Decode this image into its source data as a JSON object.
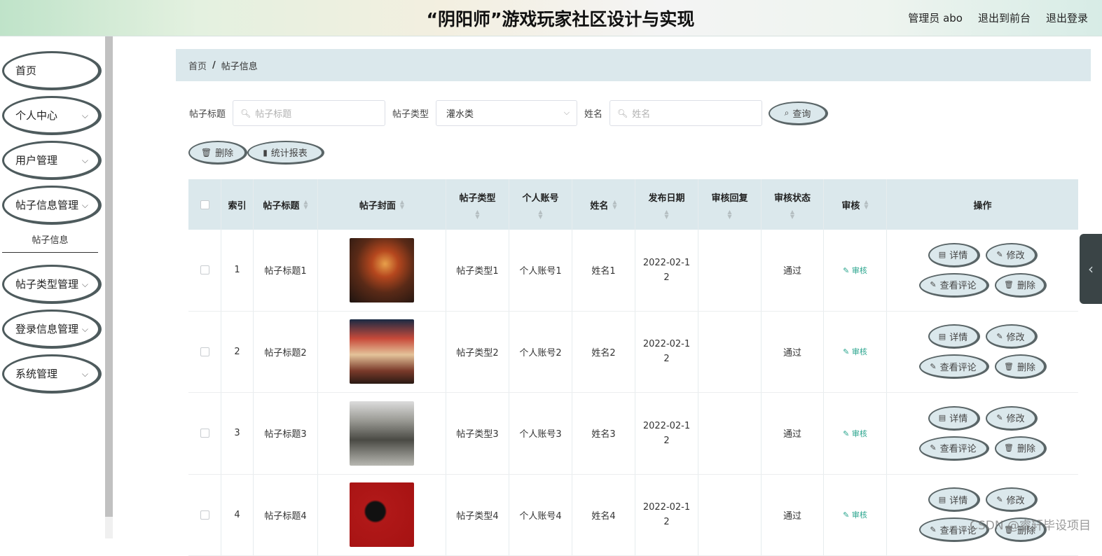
{
  "header": {
    "title": "“阴阳师”游戏玩家社区设计与实现",
    "admin_label": "管理员 abo",
    "back_to_front": "退出到前台",
    "logout": "退出登录"
  },
  "sidebar": {
    "items": [
      {
        "label": "首页"
      },
      {
        "label": "个人中心"
      },
      {
        "label": "用户管理"
      },
      {
        "label": "帖子信息管理"
      },
      {
        "label": "帖子类型管理"
      },
      {
        "label": "登录信息管理"
      },
      {
        "label": "系统管理"
      }
    ],
    "sub_item": "帖子信息"
  },
  "breadcrumb": {
    "home": "首页",
    "separator": "/",
    "current": "帖子信息"
  },
  "search": {
    "title_label": "帖子标题",
    "title_placeholder": "帖子标题",
    "type_label": "帖子类型",
    "type_value": "灌水类",
    "name_label": "姓名",
    "name_placeholder": "姓名",
    "query_button": "查询"
  },
  "toolbar": {
    "delete": "删除",
    "stats": "统计报表"
  },
  "table": {
    "headers": {
      "index": "索引",
      "title": "帖子标题",
      "cover": "帖子封面",
      "type": "帖子类型",
      "account": "个人账号",
      "name": "姓名",
      "date": "发布日期",
      "reply": "审核回复",
      "status": "审核状态",
      "audit": "审核",
      "ops": "操作"
    },
    "ops_labels": {
      "detail": "详情",
      "edit": "修改",
      "comments": "查看评论",
      "delete": "删除"
    },
    "rows": [
      {
        "index": "1",
        "title": "帖子标题1",
        "type": "帖子类型1",
        "account": "个人账号1",
        "name": "姓名1",
        "date_line1": "2022-02-1",
        "date_line2": "2",
        "reply": "",
        "status": "通过",
        "audit": "审核"
      },
      {
        "index": "2",
        "title": "帖子标题2",
        "type": "帖子类型2",
        "account": "个人账号2",
        "name": "姓名2",
        "date_line1": "2022-02-1",
        "date_line2": "2",
        "reply": "",
        "status": "通过",
        "audit": "审核"
      },
      {
        "index": "3",
        "title": "帖子标题3",
        "type": "帖子类型3",
        "account": "个人账号3",
        "name": "姓名3",
        "date_line1": "2022-02-1",
        "date_line2": "2",
        "reply": "",
        "status": "通过",
        "audit": "审核"
      },
      {
        "index": "4",
        "title": "帖子标题4",
        "type": "帖子类型4",
        "account": "个人账号4",
        "name": "姓名4",
        "date_line1": "2022-02-1",
        "date_line2": "2",
        "reply": "",
        "status": "通过",
        "audit": "审核"
      }
    ]
  },
  "watermark": "CSDN @睿轩毕设项目"
}
